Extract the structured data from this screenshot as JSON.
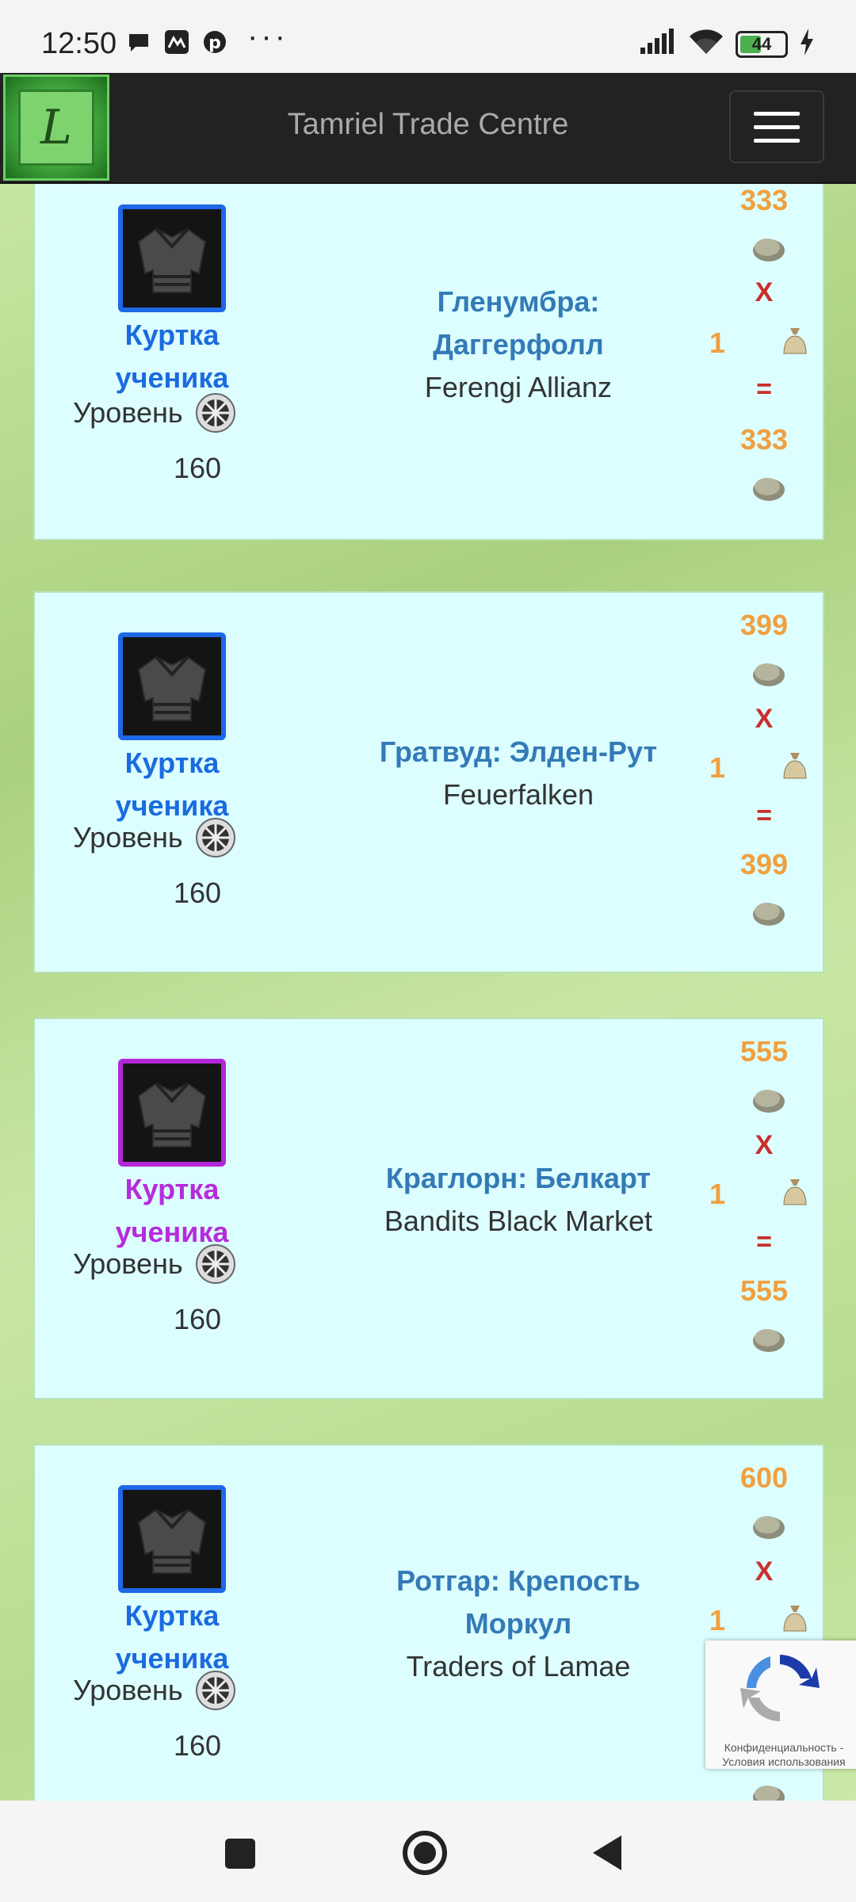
{
  "status": {
    "time": "12:50",
    "more": "···",
    "battery": "44"
  },
  "header": {
    "logo_letter": "L",
    "title": "Tamriel Trade Centre"
  },
  "listings": [
    {
      "item_name_line1": "Куртка",
      "item_name_line2": "ученика",
      "quality": "blue",
      "level_label": "Уровень",
      "level_value": "160",
      "zone_line1": "Гленумбра:",
      "zone_line2": "Даггерфолл",
      "guild": "Ferengi Allianz",
      "unit_price": "333",
      "mult": "X",
      "quantity": "1",
      "eq": "=",
      "total_price": "333"
    },
    {
      "item_name_line1": "Куртка",
      "item_name_line2": "ученика",
      "quality": "blue",
      "level_label": "Уровень",
      "level_value": "160",
      "zone_line1": "Гратвуд: Элден-Рут",
      "zone_line2": "",
      "guild": "Feuerfalken",
      "unit_price": "399",
      "mult": "X",
      "quantity": "1",
      "eq": "=",
      "total_price": "399"
    },
    {
      "item_name_line1": "Куртка",
      "item_name_line2": "ученика",
      "quality": "purple",
      "level_label": "Уровень",
      "level_value": "160",
      "zone_line1": "Краглорн: Белкарт",
      "zone_line2": "",
      "guild": "Bandits Black Market",
      "unit_price": "555",
      "mult": "X",
      "quantity": "1",
      "eq": "=",
      "total_price": "555"
    },
    {
      "item_name_line1": "Куртка",
      "item_name_line2": "ученика",
      "quality": "blue",
      "level_label": "Уровень",
      "level_value": "160",
      "zone_line1": "Ротгар: Крепость",
      "zone_line2": "Моркул",
      "guild": "Traders of Lamae",
      "unit_price": "600",
      "mult": "X",
      "quantity": "1",
      "eq": "",
      "total_price": ""
    }
  ],
  "recaptcha": {
    "text_line1": "Конфиденциальность -",
    "text_line2": "Условия использования"
  },
  "colors": {
    "blue_quality": "#1e67e6",
    "purple_quality": "#b327d8",
    "price": "#f0a040",
    "zone": "#337ab7",
    "card_bg": "#dcfefe"
  }
}
